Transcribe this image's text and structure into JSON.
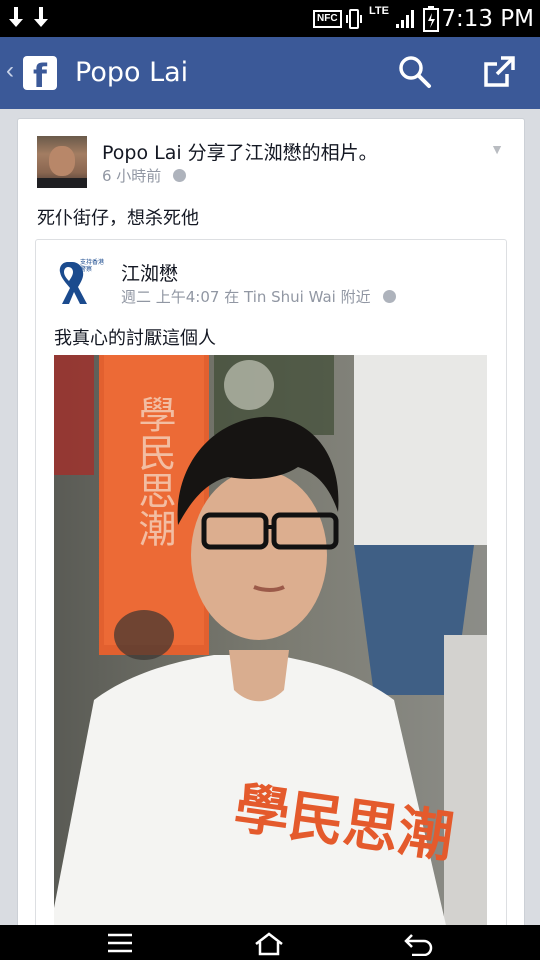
{
  "status_bar": {
    "time": "7:13 PM",
    "nfc": "NFC",
    "network": "LTE",
    "icons": [
      "download-icon",
      "download-icon",
      "nfc-icon",
      "vibrate-icon",
      "lte-icon",
      "signal-icon",
      "battery-icon"
    ]
  },
  "app_bar": {
    "title": "Popo Lai",
    "logo": "f",
    "icons": [
      "back-chevron-icon",
      "facebook-logo",
      "search-icon",
      "share-icon"
    ],
    "color": "#3b5998"
  },
  "post": {
    "author_line": "Popo Lai 分享了江洳懋的相片。",
    "time": "6 小時前",
    "caption": "死仆街仔，想杀死他",
    "shared": {
      "page_name": "江洳懋",
      "page_logo_text": "支持香港警察",
      "meta": "週二 上午4:07 在 Tin Shui Wai 附近",
      "caption": "我真心的討厭這個人",
      "photo_shirt_text": "學民思潮",
      "photo_banner_text": "學民思潮"
    }
  },
  "nav_bar": {
    "icons": [
      "menu-icon",
      "home-icon",
      "back-icon"
    ]
  }
}
